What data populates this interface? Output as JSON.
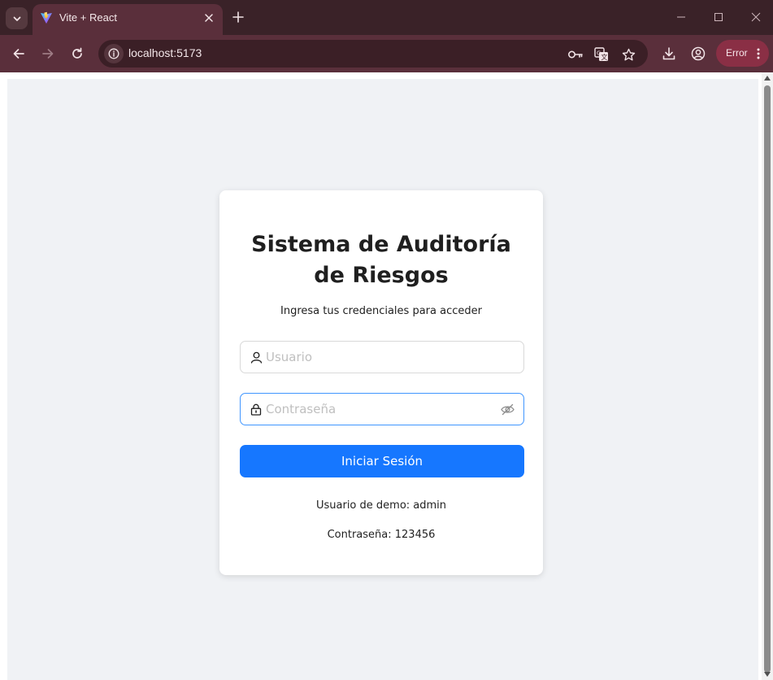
{
  "browser": {
    "tab": {
      "title": "Vite + React",
      "favicon": "vite-logo-icon"
    },
    "address_bar": {
      "url": "localhost:5173"
    },
    "profile_chip": {
      "label": "Error"
    },
    "colors": {
      "titlebar": "#3a2228",
      "toolbar": "#5a2f3b",
      "error_chip": "#8a2f45"
    }
  },
  "login": {
    "title": "Sistema de Auditoría de Riesgos",
    "subtitle": "Ingresa tus credenciales para acceder",
    "username": {
      "placeholder": "Usuario",
      "value": "",
      "icon": "user-icon"
    },
    "password": {
      "placeholder": "Contraseña",
      "value": "",
      "icon": "lock-icon",
      "toggle_icon": "eye-invisible-icon"
    },
    "submit_label": "Iniciar Sesión",
    "demo_user": "Usuario de demo: admin",
    "demo_password": "Contraseña: 123456",
    "colors": {
      "primary": "#1677ff",
      "page_background": "#f0f2f5",
      "focus_border": "#4096ff"
    }
  }
}
